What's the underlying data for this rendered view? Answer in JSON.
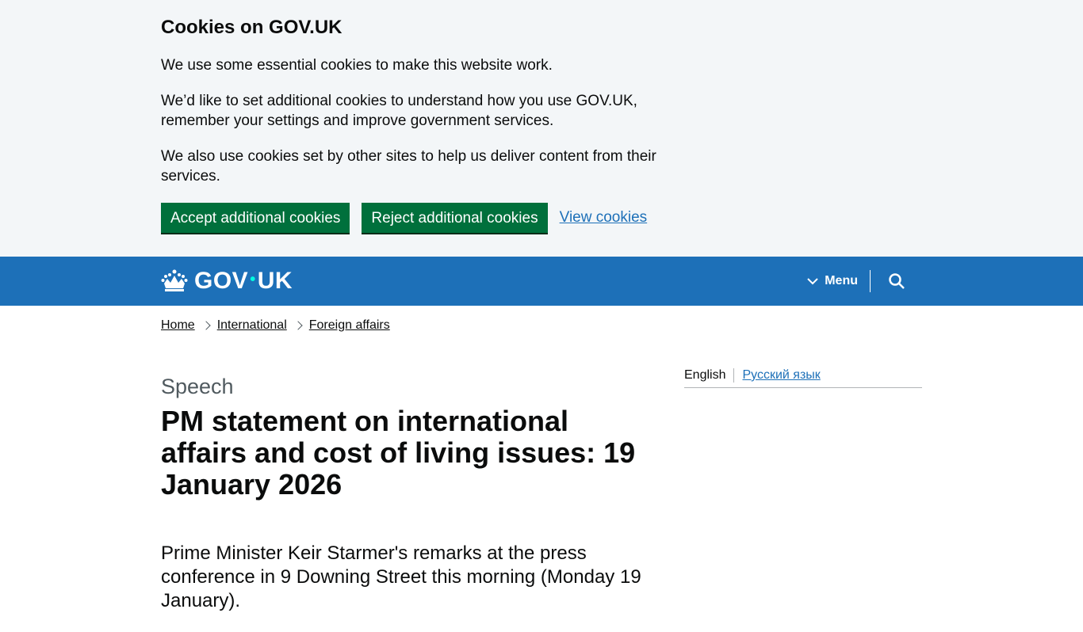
{
  "cookie_banner": {
    "title": "Cookies on GOV.UK",
    "p1": "We use some essential cookies to make this website work.",
    "p2": "We’d like to set additional cookies to understand how you use GOV.UK, remember your settings and improve government services.",
    "p3": "We also use cookies set by other sites to help us deliver content from their services.",
    "accept_label": "Accept additional cookies",
    "reject_label": "Reject additional cookies",
    "view_label": "View cookies"
  },
  "header": {
    "logo_left": "GOV",
    "logo_dot": "•",
    "logo_right": "UK",
    "menu_label": "Menu"
  },
  "breadcrumbs": [
    "Home",
    "International",
    "Foreign affairs"
  ],
  "page": {
    "caption": "Speech",
    "title": "PM statement on international affairs and cost of living issues: 19 January 2026",
    "lead": "Prime Minister Keir Starmer's remarks at the press conference in 9 Downing Street this morning (Monday 19 January)."
  },
  "languages": {
    "current": "English",
    "other": "Русский язык"
  },
  "colors": {
    "brand_blue": "#1d70b8",
    "button_green": "#00703c",
    "banner_bg": "#f3f6f8"
  }
}
